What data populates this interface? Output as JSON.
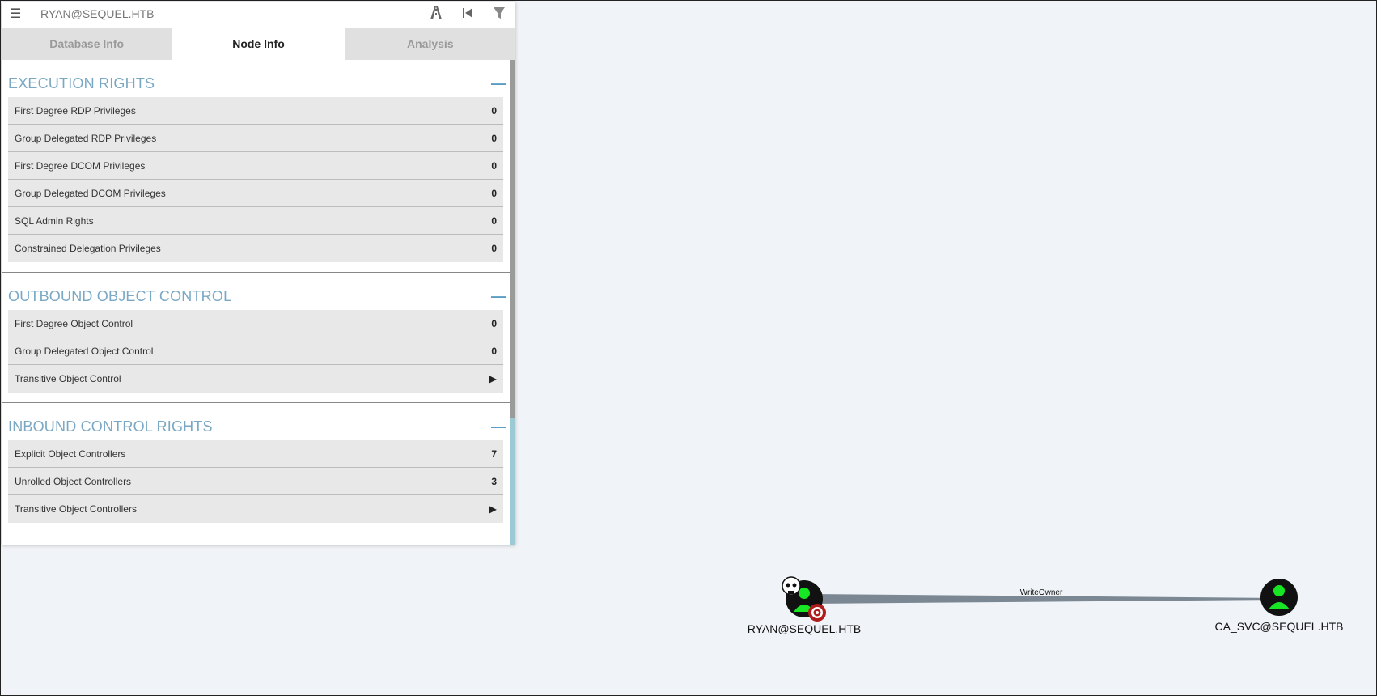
{
  "search": {
    "value": "RYAN@SEQUEL.HTB"
  },
  "tabs": [
    {
      "label": "Database Info",
      "active": false
    },
    {
      "label": "Node Info",
      "active": true
    },
    {
      "label": "Analysis",
      "active": false
    }
  ],
  "sections": [
    {
      "title": "EXECUTION RIGHTS",
      "rows": [
        {
          "label": "First Degree RDP Privileges",
          "value": "0"
        },
        {
          "label": "Group Delegated RDP Privileges",
          "value": "0"
        },
        {
          "label": "First Degree DCOM Privileges",
          "value": "0"
        },
        {
          "label": "Group Delegated DCOM Privileges",
          "value": "0"
        },
        {
          "label": "SQL Admin Rights",
          "value": "0"
        },
        {
          "label": "Constrained Delegation Privileges",
          "value": "0"
        }
      ]
    },
    {
      "title": "OUTBOUND OBJECT CONTROL",
      "rows": [
        {
          "label": "First Degree Object Control",
          "value": "0"
        },
        {
          "label": "Group Delegated Object Control",
          "value": "0"
        },
        {
          "label": "Transitive Object Control",
          "value": "▶"
        }
      ]
    },
    {
      "title": "INBOUND CONTROL RIGHTS",
      "rows": [
        {
          "label": "Explicit Object Controllers",
          "value": "7"
        },
        {
          "label": "Unrolled Object Controllers",
          "value": "3"
        },
        {
          "label": "Transitive Object Controllers",
          "value": "▶"
        }
      ]
    }
  ],
  "graph": {
    "edge_label": "WriteOwner",
    "source_node": {
      "label": "RYAN@SEQUEL.HTB",
      "icon": "user-icon",
      "badges": [
        "skull-icon",
        "target-icon"
      ]
    },
    "target_node": {
      "label": "CA_SVC@SEQUEL.HTB",
      "icon": "user-icon"
    }
  },
  "colors": {
    "node_fill": "#111111",
    "user_green": "#17e625",
    "edge": "#7b8792",
    "section_title": "#7aa8c4",
    "target_badge": "#b01c1c"
  }
}
